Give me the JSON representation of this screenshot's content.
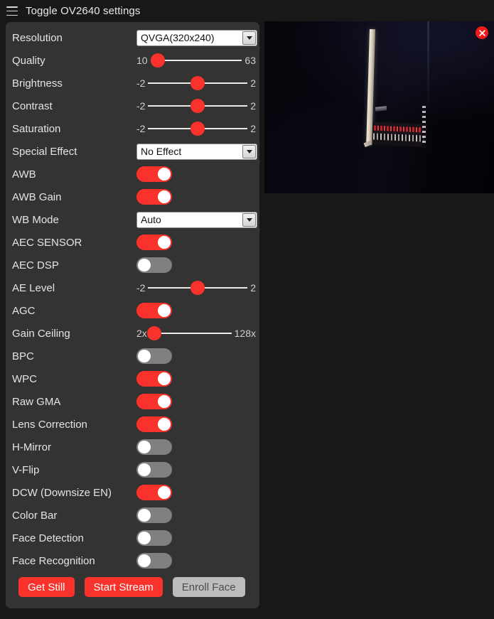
{
  "header": {
    "menu_icon": "hamburger-icon",
    "title": "Toggle OV2640 settings"
  },
  "colors": {
    "accent": "#f9322c",
    "panel_bg": "#333333",
    "page_bg": "#181818",
    "toggle_off": "#808080",
    "label_text": "#e4e4e4",
    "disabled_button": "#bdbdbd",
    "close_button": "#ef1b1b"
  },
  "settings": [
    {
      "type": "select",
      "label": "Resolution",
      "value": "QVGA(320x240)"
    },
    {
      "type": "slider",
      "label": "Quality",
      "min": "10",
      "max": "63",
      "percent": 8
    },
    {
      "type": "slider",
      "label": "Brightness",
      "min": "-2",
      "max": "2",
      "percent": 50
    },
    {
      "type": "slider",
      "label": "Contrast",
      "min": "-2",
      "max": "2",
      "percent": 50
    },
    {
      "type": "slider",
      "label": "Saturation",
      "min": "-2",
      "max": "2",
      "percent": 50
    },
    {
      "type": "select",
      "label": "Special Effect",
      "value": "No Effect"
    },
    {
      "type": "toggle",
      "label": "AWB",
      "on": true
    },
    {
      "type": "toggle",
      "label": "AWB Gain",
      "on": true
    },
    {
      "type": "select",
      "label": "WB Mode",
      "value": "Auto"
    },
    {
      "type": "toggle",
      "label": "AEC SENSOR",
      "on": true
    },
    {
      "type": "toggle",
      "label": "AEC DSP",
      "on": false
    },
    {
      "type": "slider",
      "label": "AE Level",
      "min": "-2",
      "max": "2",
      "percent": 50
    },
    {
      "type": "toggle",
      "label": "AGC",
      "on": true
    },
    {
      "type": "slider",
      "label": "Gain Ceiling",
      "min": "2x",
      "max": "128x",
      "percent": 5
    },
    {
      "type": "toggle",
      "label": "BPC",
      "on": false
    },
    {
      "type": "toggle",
      "label": "WPC",
      "on": true
    },
    {
      "type": "toggle",
      "label": "Raw GMA",
      "on": true
    },
    {
      "type": "toggle",
      "label": "Lens Correction",
      "on": true
    },
    {
      "type": "toggle",
      "label": "H-Mirror",
      "on": false
    },
    {
      "type": "toggle",
      "label": "V-Flip",
      "on": false
    },
    {
      "type": "toggle",
      "label": "DCW (Downsize EN)",
      "on": true
    },
    {
      "type": "toggle",
      "label": "Color Bar",
      "on": false
    },
    {
      "type": "toggle",
      "label": "Face Detection",
      "on": false
    },
    {
      "type": "toggle",
      "label": "Face Recognition",
      "on": false
    }
  ],
  "buttons": [
    {
      "label": "Get Still",
      "style": "primary"
    },
    {
      "label": "Start Stream",
      "style": "primary"
    },
    {
      "label": "Enroll Face",
      "style": "disabled"
    }
  ],
  "preview": {
    "close_icon": "close-x-icon",
    "description": "Dark camera still showing an illuminated vertical strip and a keyboard"
  }
}
